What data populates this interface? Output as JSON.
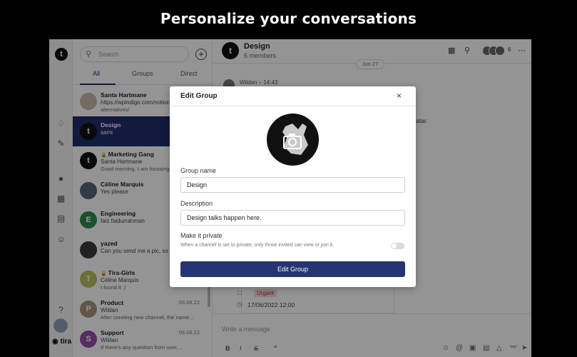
{
  "headline": "Personalize your conversations",
  "sidebar": {
    "brand": "tira",
    "icons": [
      "bell-icon",
      "compose-icon",
      "chat-icon",
      "board-icon",
      "calendar-icon",
      "people-icon",
      "help-icon"
    ]
  },
  "conversations": {
    "search_placeholder": "Search",
    "tabs": [
      {
        "label": "All",
        "active": true
      },
      {
        "label": "Groups",
        "active": false
      },
      {
        "label": "Direct",
        "active": false
      }
    ],
    "items": [
      {
        "title": "Santa Hartmane",
        "sub": "https://wpindigo.com/notion",
        "sub2": "alternatives/",
        "date": "",
        "avatar": "",
        "color": "#c9b8a8",
        "selected": false
      },
      {
        "title": "Design",
        "sub": "sami",
        "sub2": "",
        "date": "",
        "avatar": "t",
        "color": "#111111",
        "selected": true
      },
      {
        "title": "Marketing Gang",
        "sub": "Santa Hartmane",
        "sub2": "Good morning. I am focusing",
        "date": "",
        "avatar": "t",
        "color": "#111111",
        "selected": false,
        "locked": true
      },
      {
        "title": "Céline Marquis",
        "sub": "Yes please",
        "sub2": "",
        "date": "",
        "avatar": "",
        "color": "#556677",
        "selected": false
      },
      {
        "title": "Engineering",
        "sub": "faiz faidurrahman",
        "sub2": "",
        "date": "",
        "avatar": "E",
        "color": "#2f8a4f",
        "selected": false
      },
      {
        "title": "yazed",
        "sub": "Can you send me a pic, so I",
        "sub2": "",
        "date": "",
        "avatar": "",
        "color": "#3a3a3a",
        "selected": false
      },
      {
        "title": "Tira-Girls",
        "sub": "Céline Marquis",
        "sub2": "I found it :)",
        "date": "",
        "avatar": "T",
        "color": "#b9c25a",
        "selected": false,
        "locked": true
      },
      {
        "title": "Product",
        "sub": "Wildan",
        "sub2": "After creating new channel, the name...",
        "date": "06.06.22",
        "avatar": "P",
        "color": "#a6957c",
        "selected": false
      },
      {
        "title": "Support",
        "sub": "Wildan",
        "sub2": "If there's any question from user,...",
        "date": "06.06.22",
        "avatar": "S",
        "color": "#9a4fa8",
        "selected": false
      }
    ]
  },
  "chat": {
    "title": "Design",
    "members": "6 members",
    "member_count": "6",
    "date_pill": "Jun 27",
    "message_meta": "Wildan – 14:43",
    "partial_text": "vatar.",
    "tag": "Urgant",
    "datetime": "17/06/2022 12:00",
    "composer_placeholder": "Write a message",
    "format": {
      "bold": "B",
      "italic": "I",
      "strike": "S",
      "quote": "”"
    }
  },
  "modal": {
    "title": "Edit Group",
    "close": "×",
    "group_name_label": "Group name",
    "group_name_value": "Design",
    "description_label": "Description",
    "description_value": "Design talks happen here.",
    "private_label": "Make it private",
    "private_hint": "When a channel is set to private, only those invited can view or join it.",
    "private_on": false,
    "submit": "Edit Group"
  },
  "colors": {
    "accent": "#253473",
    "selected_row": "#1f2e6b",
    "urgent_bg": "#f8d7dd",
    "urgent_text": "#b03040"
  }
}
